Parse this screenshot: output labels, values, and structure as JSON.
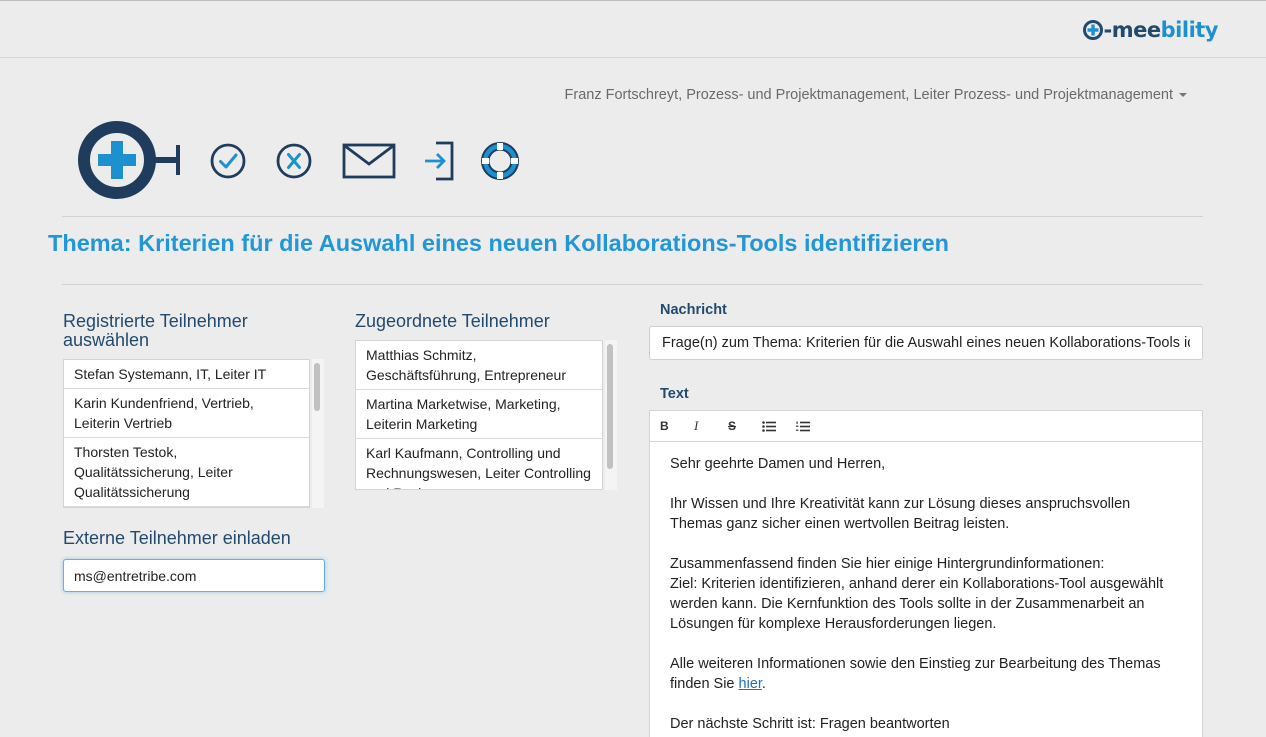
{
  "brand": {
    "name_part1": "-mee",
    "name_part2": "bility"
  },
  "user_menu": {
    "label": "Franz Fortschreyt, Prozess- und Projektmanagement, Leiter Prozess- und Projektmanagement"
  },
  "page": {
    "title": "Thema: Kriterien für die Auswahl eines neuen Kollaborations-Tools identifizieren"
  },
  "registered": {
    "heading": "Registrierte Teilnehmer auswählen",
    "items": [
      {
        "label": "Stefan Systemann, IT, Leiter IT"
      },
      {
        "label": "Karin Kundenfriend, Vertrieb, Leiterin Vertrieb"
      },
      {
        "label": "Thorsten Testok, Qualitätssicherung, Leiter Qualitätssicherung"
      }
    ]
  },
  "assigned": {
    "heading": "Zugeordnete Teilnehmer",
    "items": [
      {
        "label": "Matthias Schmitz, Geschäftsführung, Entrepreneur"
      },
      {
        "label": "Martina Marketwise, Marketing, Leiterin Marketing"
      },
      {
        "label": "Karl Kaufmann, Controlling und Rechnungswesen, Leiter Controlling und Rechnungswesen"
      }
    ]
  },
  "external": {
    "heading": "Externe Teilnehmer einladen",
    "value": "ms@entretribe.com"
  },
  "message": {
    "label": "Nachricht",
    "subject": "Frage(n) zum Thema: Kriterien für die Auswahl eines neuen Kollaborations-Tools identifizieren",
    "text_label": "Text",
    "toolbar": {
      "bold": "B",
      "italic": "I",
      "strike": "S"
    },
    "body": {
      "greeting": "Sehr geehrte Damen und Herren,",
      "p1": "Ihr Wissen und Ihre Kreativität kann zur Lösung dieses anspruchsvollen Themas ganz sicher einen wertvollen Beitrag leisten.",
      "p2_line1": "Zusammenfassend finden Sie hier einige Hintergrundinformationen:",
      "p2_line2": "Ziel: Kriterien identifizieren, anhand derer ein Kollaborations-Tool ausgewählt werden kann. Die Kernfunktion des Tools sollte in der Zusammenarbeit an Lösungen für komplexe Herausforderungen liegen.",
      "p3_before": "Alle weiteren Informationen sowie den Einstieg zur Bearbeitung des Themas finden Sie ",
      "p3_link": "hier",
      "p3_after": ".",
      "p4": "Der nächste Schritt ist: Fragen beantworten"
    }
  },
  "colors": {
    "accent": "#1d91d0",
    "navy": "#234a6d",
    "title": "#2197d8"
  },
  "icons": [
    "plus-circle-key-icon",
    "check-circle-icon",
    "x-circle-icon",
    "envelope-icon",
    "sign-in-icon",
    "lifebuoy-icon"
  ]
}
